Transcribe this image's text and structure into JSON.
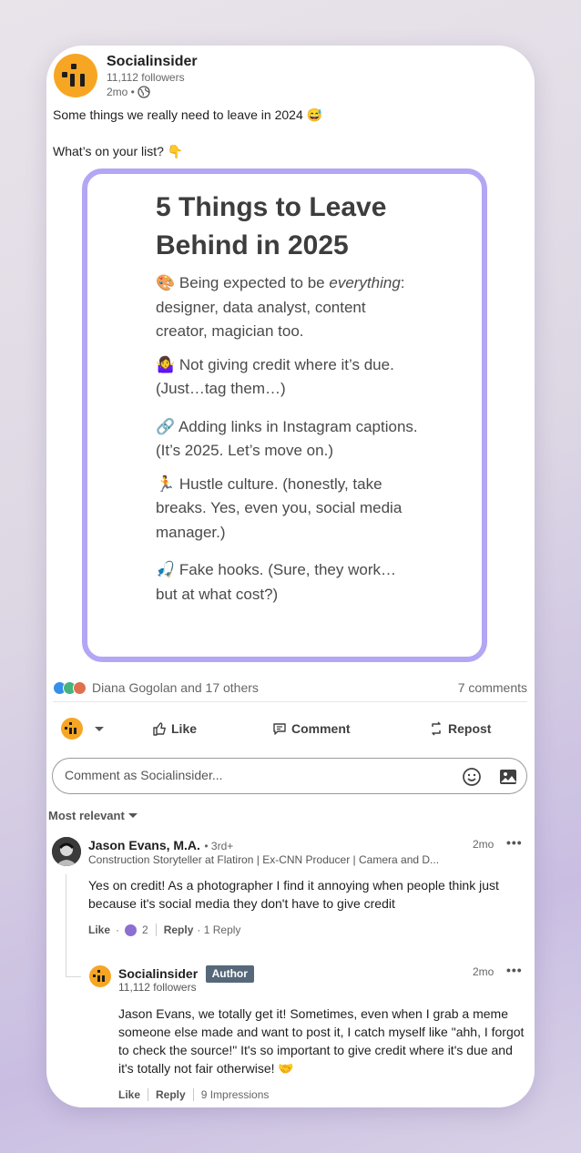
{
  "post": {
    "author": "Socialinsider",
    "followers": "11,112 followers",
    "age": "2mo •",
    "line1": "Some things we really need to leave in 2024 😅",
    "line2": "What’s on your list? 👇"
  },
  "image": {
    "title": "5 Things to Leave Behind in 2025",
    "item1_emoji": "🎨",
    "item1_a": " Being expected to be ",
    "item1_em": "everything",
    "item1_b": ": designer, data analyst, content creator, magician too.",
    "item2": "🤷‍♀️ Not giving credit where it’s due. (Just…tag them…)",
    "item3": "🔗 Adding links in Instagram captions. (It’s 2025. Let’s move on.)",
    "item4": "🏃 Hustle culture. (honestly, take breaks. Yes, even you, social media manager.)",
    "item5": "🎣 Fake hooks. (Sure, they work… but at what cost?)"
  },
  "reactions": {
    "text": "Diana Gogolan and 17 others",
    "comments": "7 comments"
  },
  "actions": {
    "like": "Like",
    "comment": "Comment",
    "repost": "Repost"
  },
  "comment_box": {
    "placeholder": "Comment as Socialinsider..."
  },
  "sort": {
    "label": "Most relevant"
  },
  "comments": [
    {
      "name": "Jason Evans, M.A.",
      "degree": "• 3rd+",
      "headline": "Construction Storyteller at Flatiron | Ex-CNN Producer | Camera and D...",
      "time": "2mo",
      "text": "Yes on credit! As a photographer I find it annoying when people think just because it's social media they don't have to give credit",
      "like": "Like",
      "dot": "·",
      "reaction_count": "2",
      "reply": "Reply",
      "replies": "· 1 Reply"
    },
    {
      "name": "Socialinsider",
      "badge": "Author",
      "followers": "11,112 followers",
      "time": "2mo",
      "text": "Jason Evans, we totally get it! Sometimes, even when I grab a meme someone else made and want to post it, I catch myself like \"ahh, I forgot to check the source!\" It's so important to give credit where it's due and it's totally not fair otherwise! 🤝",
      "like": "Like",
      "reply": "Reply",
      "impressions": "9 Impressions"
    }
  ]
}
